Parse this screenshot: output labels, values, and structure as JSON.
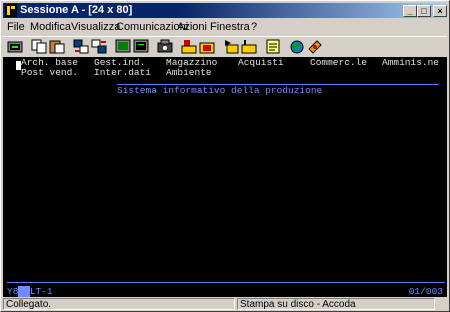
{
  "window": {
    "title": "Sessione A - [24 x 80]",
    "controls": [
      "_",
      "□",
      "×"
    ]
  },
  "menu": [
    "File",
    "Modifica",
    "Visualizza",
    "Comunicazioni",
    "Azioni",
    "Finestra",
    "?"
  ],
  "toolbar": {
    "buttons": [
      "print-screen-icon",
      "copy-icon",
      "paste-icon",
      "send-file-icon",
      "receive-file-icon",
      "display-setup-icon",
      "display-icon",
      "macro-record-icon",
      "macro-stop-icon",
      "macro-play-icon",
      "macro-edit-icon",
      "notepad-icon",
      "globe-icon",
      "help-icon"
    ]
  },
  "terminal": {
    "menu_row1": [
      "Arch. base",
      "Gest.ind.",
      "Magazzino",
      "Acquisti",
      "Commerc.le",
      "Amminis.ne"
    ],
    "menu_row2": [
      "Post vend.",
      "Inter.dati",
      "Ambiente"
    ],
    "system_title": "Sistema informativo della produzione",
    "oia_left_a": "Y8",
    "oia_left_hl": "  ",
    "oia_left_b": "LT-1",
    "oia_right": "01/003"
  },
  "status": {
    "connection": "Collegato.",
    "print": "Stampa su disco - Accoda"
  },
  "colors": {
    "title_start": "#0a246a",
    "title_end": "#a6caf0",
    "terminal_bg": "#000000",
    "terminal_text": "#e0e0e0",
    "terminal_accent": "#6f8cff"
  }
}
